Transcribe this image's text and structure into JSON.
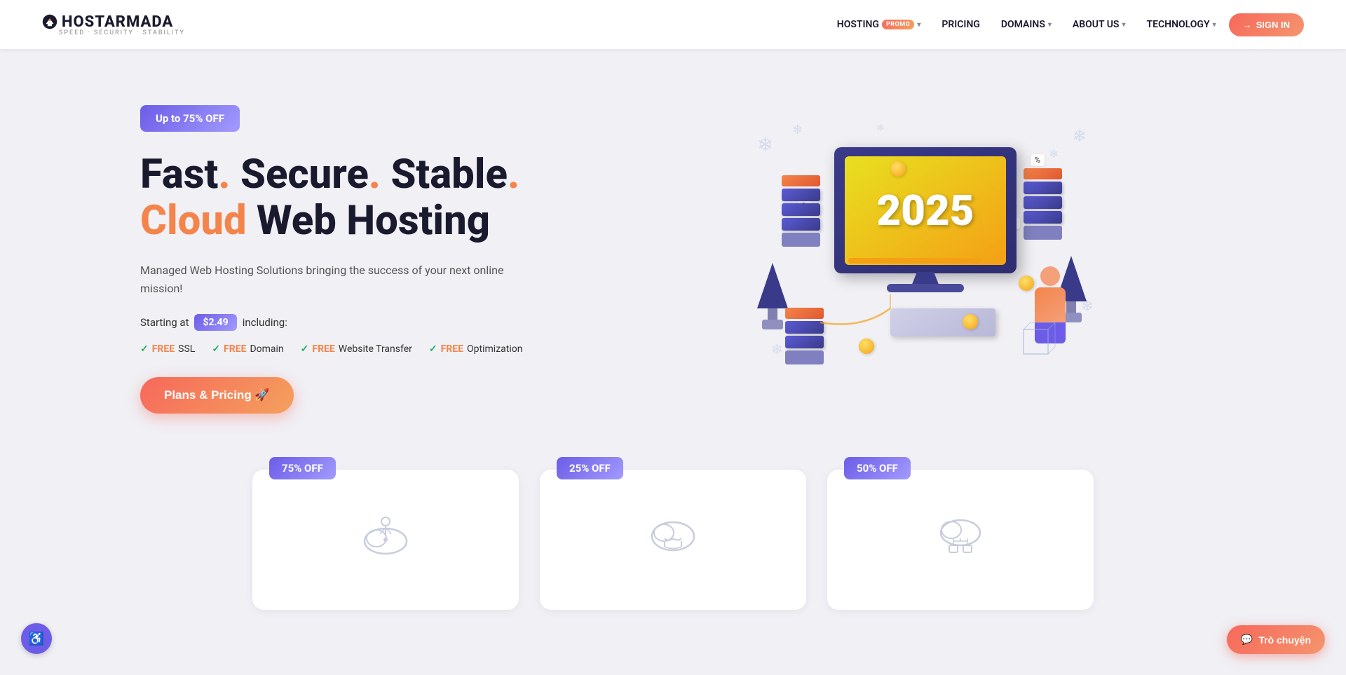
{
  "brand": {
    "name": "HOSTARMADA",
    "icon": "⚓",
    "tagline": "SPEED · SECURITY · STABILITY"
  },
  "navbar": {
    "hosting_label": "HOSTING",
    "hosting_badge": "PROMO",
    "pricing_label": "PRICING",
    "domains_label": "DOMAINS",
    "about_label": "ABOUT US",
    "technology_label": "TECHNOLOGY",
    "signin_label": "SIGN IN"
  },
  "hero": {
    "promo_badge": "Up to 75% OFF",
    "title_line1": "Fast",
    "title_dot1": ".",
    "title_line2": "Secure",
    "title_dot2": ".",
    "title_line3": "Stable",
    "title_dot3": ".",
    "title_line4": "Cloud Web Hosting",
    "subtitle": "Managed Web Hosting Solutions bringing the success of your next online mission!",
    "starting_at": "Starting at",
    "price": "$2.49",
    "including": "including:",
    "free1_check": "✓",
    "free1_word": "FREE",
    "free1_text": "SSL",
    "free2_check": "✓",
    "free2_word": "FREE",
    "free2_text": "Domain",
    "free3_check": "✓",
    "free3_word": "FREE",
    "free3_text": "Website Transfer",
    "free4_check": "✓",
    "free4_word": "FREE",
    "free4_text": "Optimization",
    "cta_label": "Plans & Pricing 🚀",
    "monitor_year": "2025"
  },
  "cards": [
    {
      "badge": "75% OFF",
      "badge_style": "purple",
      "icon": "cloud-signal"
    },
    {
      "badge": "25% OFF",
      "badge_style": "purple",
      "icon": "cloud-handshake"
    },
    {
      "badge": "50% OFF",
      "badge_style": "purple",
      "icon": "cloud-nodes"
    }
  ],
  "chat": {
    "label": "Trò chuyện",
    "icon": "💬"
  },
  "accessibility": {
    "icon": "♿"
  }
}
